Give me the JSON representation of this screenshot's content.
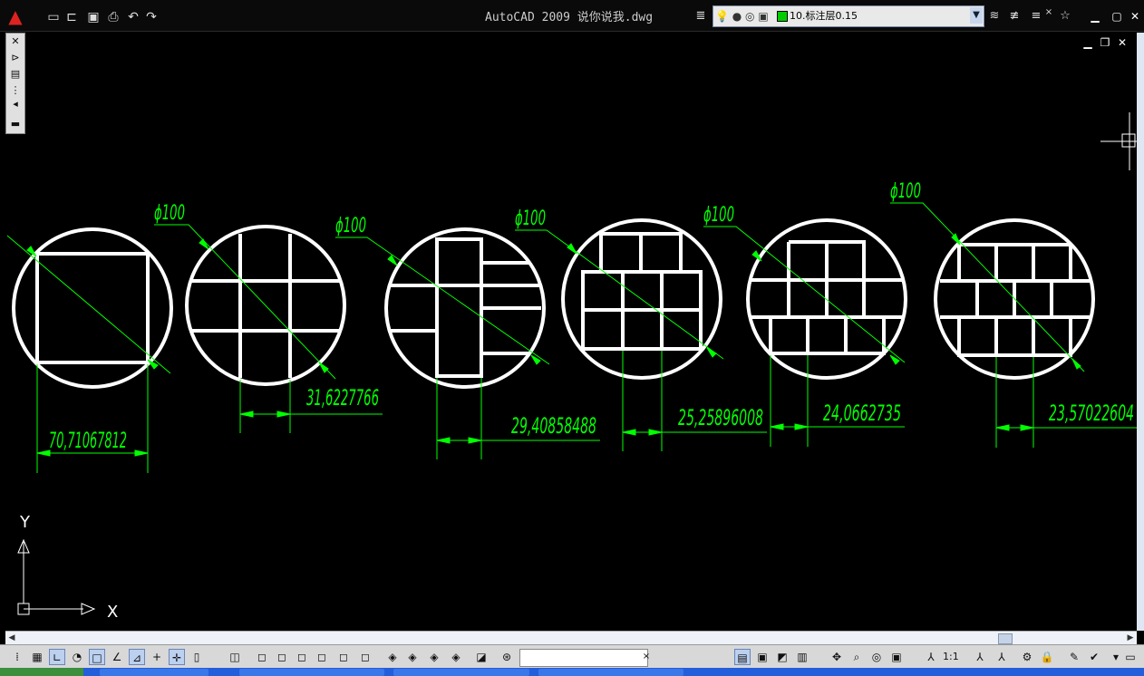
{
  "window": {
    "title": "AutoCAD 2009  说你说我.dwg",
    "logo_icon": "autocad-logo-icon"
  },
  "quick_access": [
    "new-icon",
    "open-icon",
    "save-icon",
    "print-icon",
    "undo-icon",
    "redo-icon"
  ],
  "layer": {
    "current": "10.标注层0.15",
    "color": "#00cc00"
  },
  "viewport_controls": [
    "minimize-icon",
    "restore-icon",
    "close-icon"
  ],
  "drawing": {
    "line_color": "#ffffff",
    "dim_color": "#00ff00",
    "diameter_label": "ϕ100",
    "dimensions": [
      "70,71067812",
      "31,6227766",
      "29,40858488",
      "25,25896008",
      "24,0662735",
      "23,57022604"
    ],
    "ucs": {
      "x_label": "X",
      "y_label": "Y"
    }
  },
  "status": {
    "scale": "1:1",
    "command_value": ""
  },
  "colors": {
    "canvas": "#000000",
    "accent": "#00ff00",
    "taskbar": "#245edb"
  }
}
